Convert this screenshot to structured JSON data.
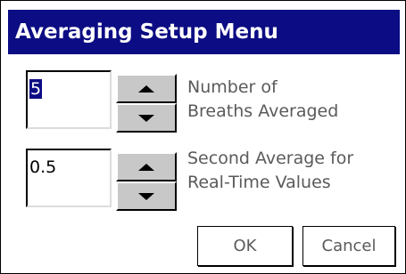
{
  "dialog": {
    "title": "Averaging Setup Menu"
  },
  "breaths_averaged": {
    "value": "5",
    "label_line1": "Number of",
    "label_line2": "Breaths Averaged"
  },
  "second_average": {
    "value": "0.5",
    "label_line1": "Second Average for",
    "label_line2": "Real-Time Values"
  },
  "buttons": {
    "ok": "OK",
    "cancel": "Cancel"
  },
  "colors": {
    "titlebar": "#0c0c84",
    "button_face": "#c8c8c8",
    "label_text": "#5a5a5a"
  },
  "icons": {
    "spin_up": "triangle-up",
    "spin_down": "triangle-down"
  }
}
